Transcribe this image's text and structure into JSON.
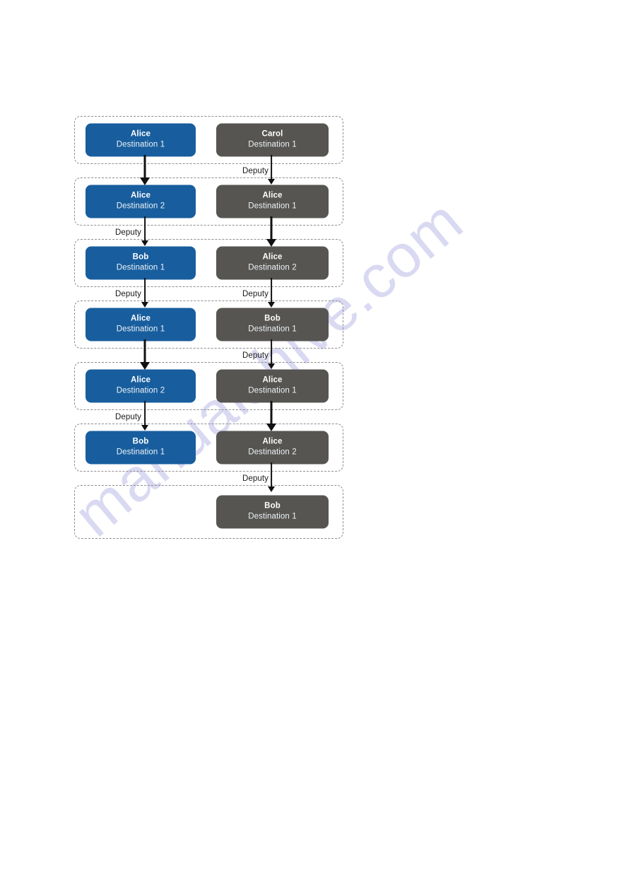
{
  "watermark": {
    "text": "manualshive.com",
    "color": "#d9d9f2"
  },
  "palette": {
    "left_node_bg": "#185e9e",
    "right_node_bg": "#565552",
    "node_text": "#ffffff",
    "container_border": "#8d8d8d",
    "arrow": "#111111",
    "page_bg": "#ffffff"
  },
  "diagram": {
    "type": "flow-sequence",
    "columns": [
      "left",
      "right"
    ],
    "edge_label": "Deputy",
    "rows": [
      {
        "index": 1,
        "left": {
          "name": "Alice",
          "destination": "Destination 1"
        },
        "right": {
          "name": "Carol",
          "destination": "Destination 1"
        }
      },
      {
        "index": 2,
        "left": {
          "name": "Alice",
          "destination": "Destination 2"
        },
        "right": {
          "name": "Alice",
          "destination": "Destination 1"
        }
      },
      {
        "index": 3,
        "left": {
          "name": "Bob",
          "destination": "Destination 1"
        },
        "right": {
          "name": "Alice",
          "destination": "Destination 2"
        }
      },
      {
        "index": 4,
        "left": {
          "name": "Alice",
          "destination": "Destination 1"
        },
        "right": {
          "name": "Bob",
          "destination": "Destination 1"
        }
      },
      {
        "index": 5,
        "left": {
          "name": "Alice",
          "destination": "Destination 2"
        },
        "right": {
          "name": "Alice",
          "destination": "Destination 1"
        }
      },
      {
        "index": 6,
        "left": {
          "name": "Bob",
          "destination": "Destination 1"
        },
        "right": {
          "name": "Alice",
          "destination": "Destination 2"
        }
      },
      {
        "index": 7,
        "left": null,
        "right": {
          "name": "Bob",
          "destination": "Destination 1"
        }
      }
    ],
    "edges": [
      {
        "column": "left",
        "from_row": 1,
        "to_row": 2,
        "label": "",
        "weight": "thick"
      },
      {
        "column": "right",
        "from_row": 1,
        "to_row": 2,
        "label": "Deputy",
        "weight": "thin"
      },
      {
        "column": "left",
        "from_row": 2,
        "to_row": 3,
        "label": "Deputy",
        "weight": "thin"
      },
      {
        "column": "right",
        "from_row": 2,
        "to_row": 3,
        "label": "",
        "weight": "thick"
      },
      {
        "column": "left",
        "from_row": 3,
        "to_row": 4,
        "label": "Deputy",
        "weight": "thin"
      },
      {
        "column": "right",
        "from_row": 3,
        "to_row": 4,
        "label": "Deputy",
        "weight": "thin"
      },
      {
        "column": "left",
        "from_row": 4,
        "to_row": 5,
        "label": "",
        "weight": "thick"
      },
      {
        "column": "right",
        "from_row": 4,
        "to_row": 5,
        "label": "Deputy",
        "weight": "thin"
      },
      {
        "column": "left",
        "from_row": 5,
        "to_row": 6,
        "label": "Deputy",
        "weight": "thin"
      },
      {
        "column": "right",
        "from_row": 5,
        "to_row": 6,
        "label": "",
        "weight": "thick"
      },
      {
        "column": "right",
        "from_row": 6,
        "to_row": 7,
        "label": "Deputy",
        "weight": "thin"
      }
    ]
  }
}
